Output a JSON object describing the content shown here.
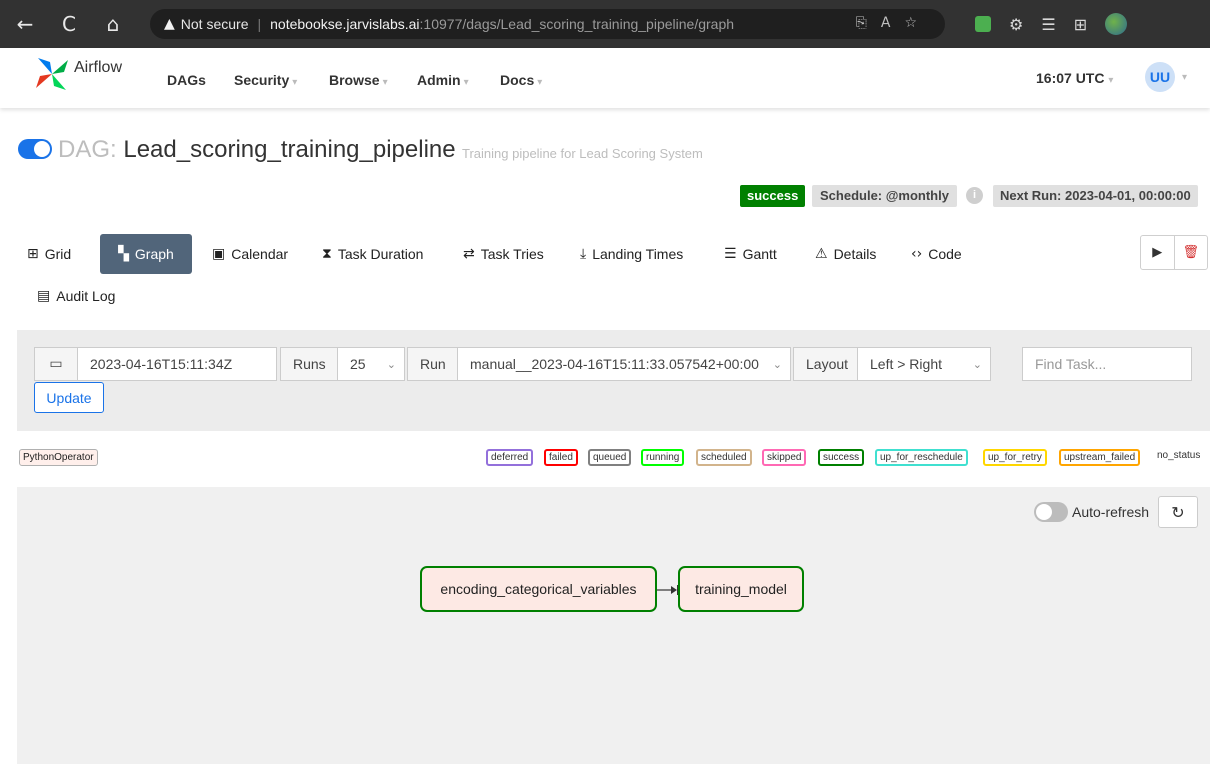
{
  "browser": {
    "nav": {
      "back": "←",
      "reload": "C",
      "home": "⌂"
    },
    "address": {
      "security_warning": "Not secure",
      "host": "notebookse.jarvislabs.ai",
      "path": ":10977/dags/Lead_scoring_training_pipeline/graph"
    },
    "icons": [
      "share-icon",
      "read-aloud-icon",
      "favorite-icon",
      "extension-icon",
      "extensions-icon",
      "favorites-icon",
      "collections-icon",
      "profile-icon"
    ]
  },
  "navbar": {
    "brand": "Airflow",
    "menu": [
      {
        "label": "DAGs",
        "has_caret": false
      },
      {
        "label": "Security",
        "has_caret": true
      },
      {
        "label": "Browse",
        "has_caret": true
      },
      {
        "label": "Admin",
        "has_caret": true
      },
      {
        "label": "Docs",
        "has_caret": true
      }
    ],
    "clock": "16:07 UTC",
    "user_initials": "UU"
  },
  "dag": {
    "prefix": "DAG:",
    "id": "Lead_scoring_training_pipeline",
    "description": "Training pipeline for Lead Scoring System",
    "status": "success",
    "schedule": "Schedule: @monthly",
    "next_run": "Next Run: 2023-04-01, 00:00:00"
  },
  "tabs": [
    {
      "label": "Grid",
      "icon": "grid-icon",
      "active": false
    },
    {
      "label": "Graph",
      "icon": "graph-icon",
      "active": true
    },
    {
      "label": "Calendar",
      "icon": "calendar-icon",
      "active": false
    },
    {
      "label": "Task Duration",
      "icon": "hourglass-icon",
      "active": false
    },
    {
      "label": "Task Tries",
      "icon": "repeat-icon",
      "active": false
    },
    {
      "label": "Landing Times",
      "icon": "landing-icon",
      "active": false
    },
    {
      "label": "Gantt",
      "icon": "gantt-icon",
      "active": false
    },
    {
      "label": "Details",
      "icon": "warning-triangle-icon",
      "active": false
    },
    {
      "label": "Code",
      "icon": "code-icon",
      "active": false
    },
    {
      "label": "Audit Log",
      "icon": "audit-log-icon",
      "active": false
    }
  ],
  "filters": {
    "base_date": "2023-04-16T15:11:34Z",
    "runs_label": "Runs",
    "runs_value": "25",
    "run_label": "Run",
    "run_value": "manual__2023-04-16T15:11:33.057542+00:00",
    "layout_label": "Layout",
    "layout_value": "Left > Right",
    "find_task_placeholder": "Find Task...",
    "update_label": "Update"
  },
  "legend": {
    "operator": "PythonOperator",
    "states": [
      {
        "label": "deferred",
        "color": "#9370db"
      },
      {
        "label": "failed",
        "color": "#ff0000"
      },
      {
        "label": "queued",
        "color": "#808080"
      },
      {
        "label": "running",
        "color": "#00ff00"
      },
      {
        "label": "scheduled",
        "color": "#d2b48c"
      },
      {
        "label": "skipped",
        "color": "#ff69b4"
      },
      {
        "label": "success",
        "color": "#008000"
      },
      {
        "label": "up_for_reschedule",
        "color": "#40e0d0"
      },
      {
        "label": "up_for_retry",
        "color": "#ffd700"
      },
      {
        "label": "upstream_failed",
        "color": "#ffa500"
      },
      {
        "label": "no_status",
        "color": ""
      }
    ]
  },
  "graph": {
    "auto_refresh_label": "Auto-refresh",
    "auto_refresh_enabled": false,
    "tasks": [
      {
        "id": "encoding_categorical_variables",
        "state": "success",
        "operator": "PythonOperator"
      },
      {
        "id": "training_model",
        "state": "success",
        "operator": "PythonOperator"
      }
    ],
    "edges": [
      {
        "from": "encoding_categorical_variables",
        "to": "training_model"
      }
    ]
  },
  "colors": {
    "accent": "#1a73e8",
    "active_tab": "#51657a",
    "success": "#008000",
    "task_fill": "#fde9e4"
  }
}
